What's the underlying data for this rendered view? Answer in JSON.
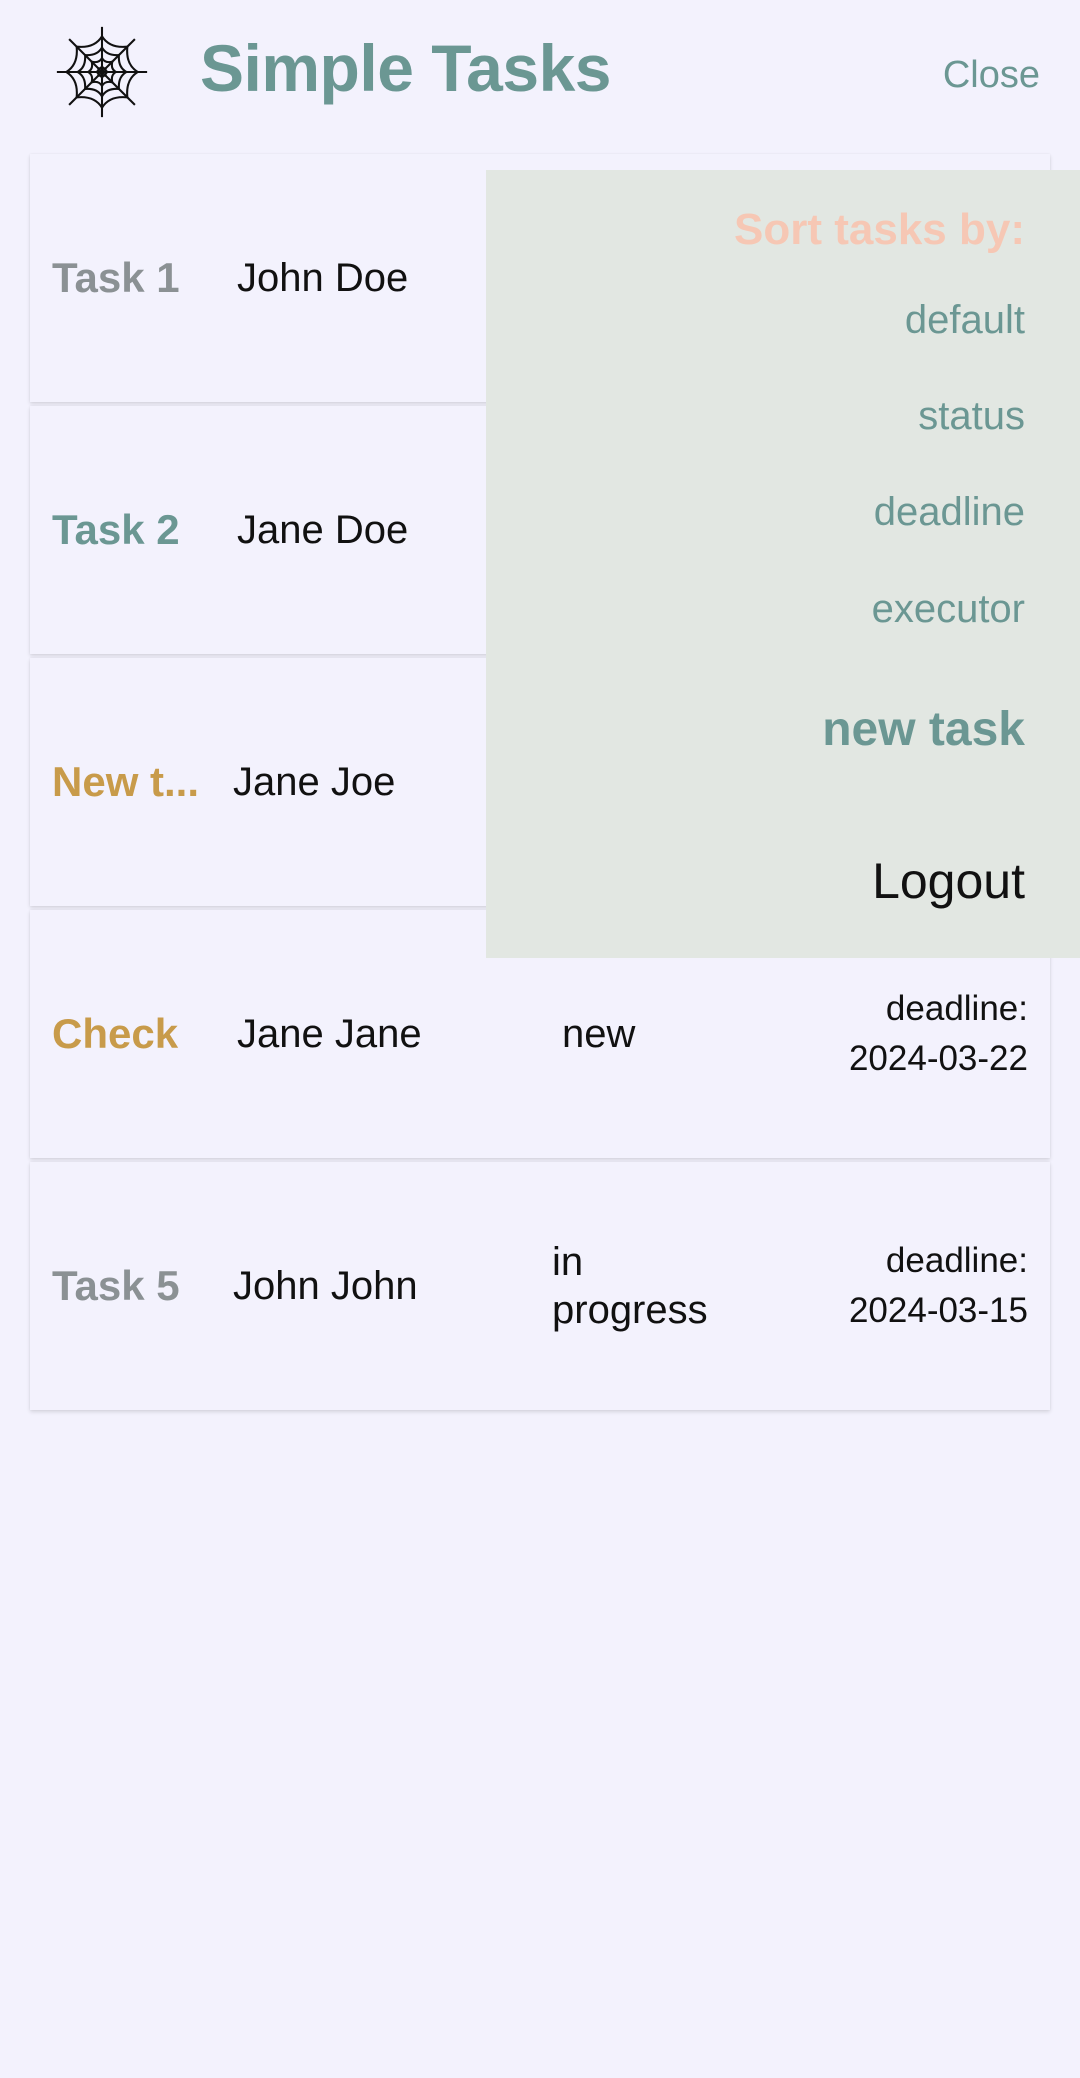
{
  "header": {
    "title": "Simple Tasks",
    "close_label": "Close",
    "logo_icon": "spider-web-icon"
  },
  "tasks": [
    {
      "title": "Task 1",
      "title_color": "#8b9194",
      "executor": "John Doe",
      "status": "",
      "deadline_label": "",
      "deadline": ""
    },
    {
      "title": "Task 2",
      "title_color": "#6b9793",
      "executor": "Jane Doe",
      "status": "",
      "deadline_label": "",
      "deadline": ""
    },
    {
      "title": "New t...",
      "title_color": "#c89b4a",
      "executor": "Jane Joe",
      "status": "",
      "deadline_label": "",
      "deadline": ""
    },
    {
      "title": "Check",
      "title_color": "#c89b4a",
      "executor": "Jane Jane",
      "status": "new",
      "deadline_label": "deadline:",
      "deadline": "2024-03-22"
    },
    {
      "title": "Task 5",
      "title_color": "#8b9194",
      "executor": "John John",
      "status": "in progress",
      "deadline_label": "deadline:",
      "deadline": "2024-03-15"
    }
  ],
  "menu": {
    "heading": "Sort tasks by:",
    "options": [
      "default",
      "status",
      "deadline",
      "executor"
    ],
    "new_task_label": "new task",
    "logout_label": "Logout"
  },
  "colors": {
    "accent": "#6b9793",
    "heading": "#f6c7b4",
    "background": "#f3f2fd",
    "menu_background": "#e2e7e2"
  }
}
